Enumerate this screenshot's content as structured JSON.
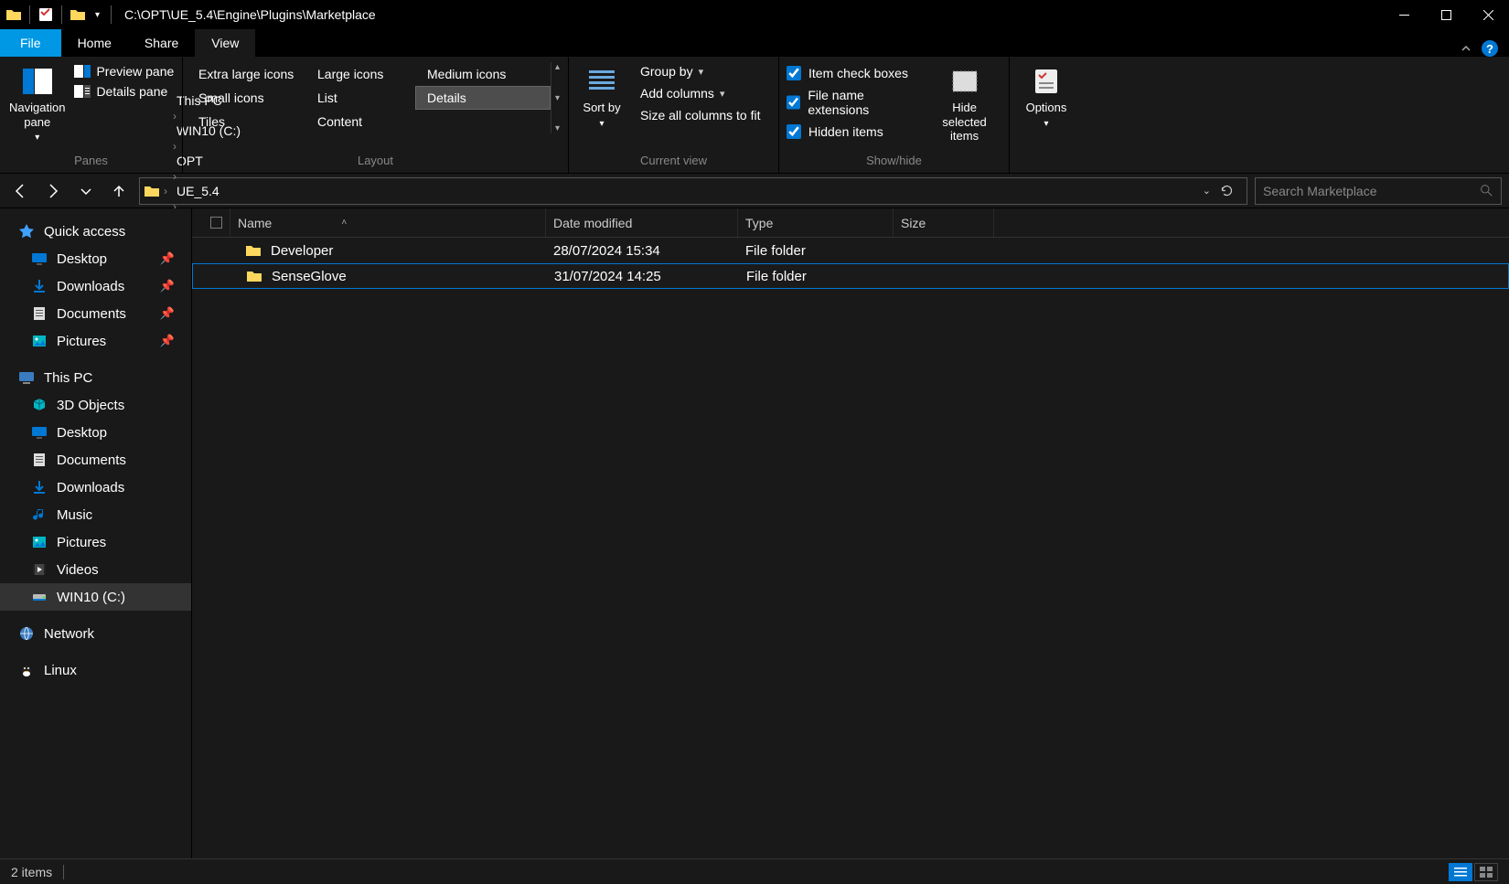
{
  "title_path": "C:\\OPT\\UE_5.4\\Engine\\Plugins\\Marketplace",
  "tabs": {
    "file": "File",
    "home": "Home",
    "share": "Share",
    "view": "View"
  },
  "ribbon": {
    "panes": {
      "label": "Panes",
      "navigation": "Navigation pane",
      "preview": "Preview pane",
      "details": "Details pane"
    },
    "layout": {
      "label": "Layout",
      "extra_large": "Extra large icons",
      "large": "Large icons",
      "medium": "Medium icons",
      "small": "Small icons",
      "list": "List",
      "details": "Details",
      "tiles": "Tiles",
      "content": "Content"
    },
    "current_view": {
      "label": "Current view",
      "sort_by": "Sort by",
      "group_by": "Group by",
      "add_columns": "Add columns",
      "size_all": "Size all columns to fit"
    },
    "show_hide": {
      "label": "Show/hide",
      "item_check": "Item check boxes",
      "file_ext": "File name extensions",
      "hidden": "Hidden items",
      "hide_selected": "Hide selected items"
    },
    "options": "Options"
  },
  "breadcrumbs": [
    "This PC",
    "WIN10 (C:)",
    "OPT",
    "UE_5.4",
    "Engine",
    "Plugins",
    "Marketplace"
  ],
  "search": {
    "placeholder": "Search Marketplace"
  },
  "sidebar": {
    "quick_access": "Quick access",
    "quick_items": [
      {
        "label": "Desktop",
        "pinned": true,
        "icon": "monitor"
      },
      {
        "label": "Downloads",
        "pinned": true,
        "icon": "download"
      },
      {
        "label": "Documents",
        "pinned": true,
        "icon": "doc"
      },
      {
        "label": "Pictures",
        "pinned": true,
        "icon": "picture"
      }
    ],
    "this_pc": "This PC",
    "pc_items": [
      {
        "label": "3D Objects",
        "icon": "cube"
      },
      {
        "label": "Desktop",
        "icon": "monitor"
      },
      {
        "label": "Documents",
        "icon": "doc"
      },
      {
        "label": "Downloads",
        "icon": "download"
      },
      {
        "label": "Music",
        "icon": "music"
      },
      {
        "label": "Pictures",
        "icon": "picture"
      },
      {
        "label": "Videos",
        "icon": "video"
      },
      {
        "label": "WIN10 (C:)",
        "icon": "drive",
        "selected": true
      }
    ],
    "network": "Network",
    "linux": "Linux"
  },
  "columns": {
    "name": "Name",
    "date": "Date modified",
    "type": "Type",
    "size": "Size"
  },
  "files": [
    {
      "name": "Developer",
      "date": "28/07/2024 15:34",
      "type": "File folder",
      "size": ""
    },
    {
      "name": "SenseGlove",
      "date": "31/07/2024 14:25",
      "type": "File folder",
      "size": "",
      "selected": true
    }
  ],
  "status": "2 items"
}
